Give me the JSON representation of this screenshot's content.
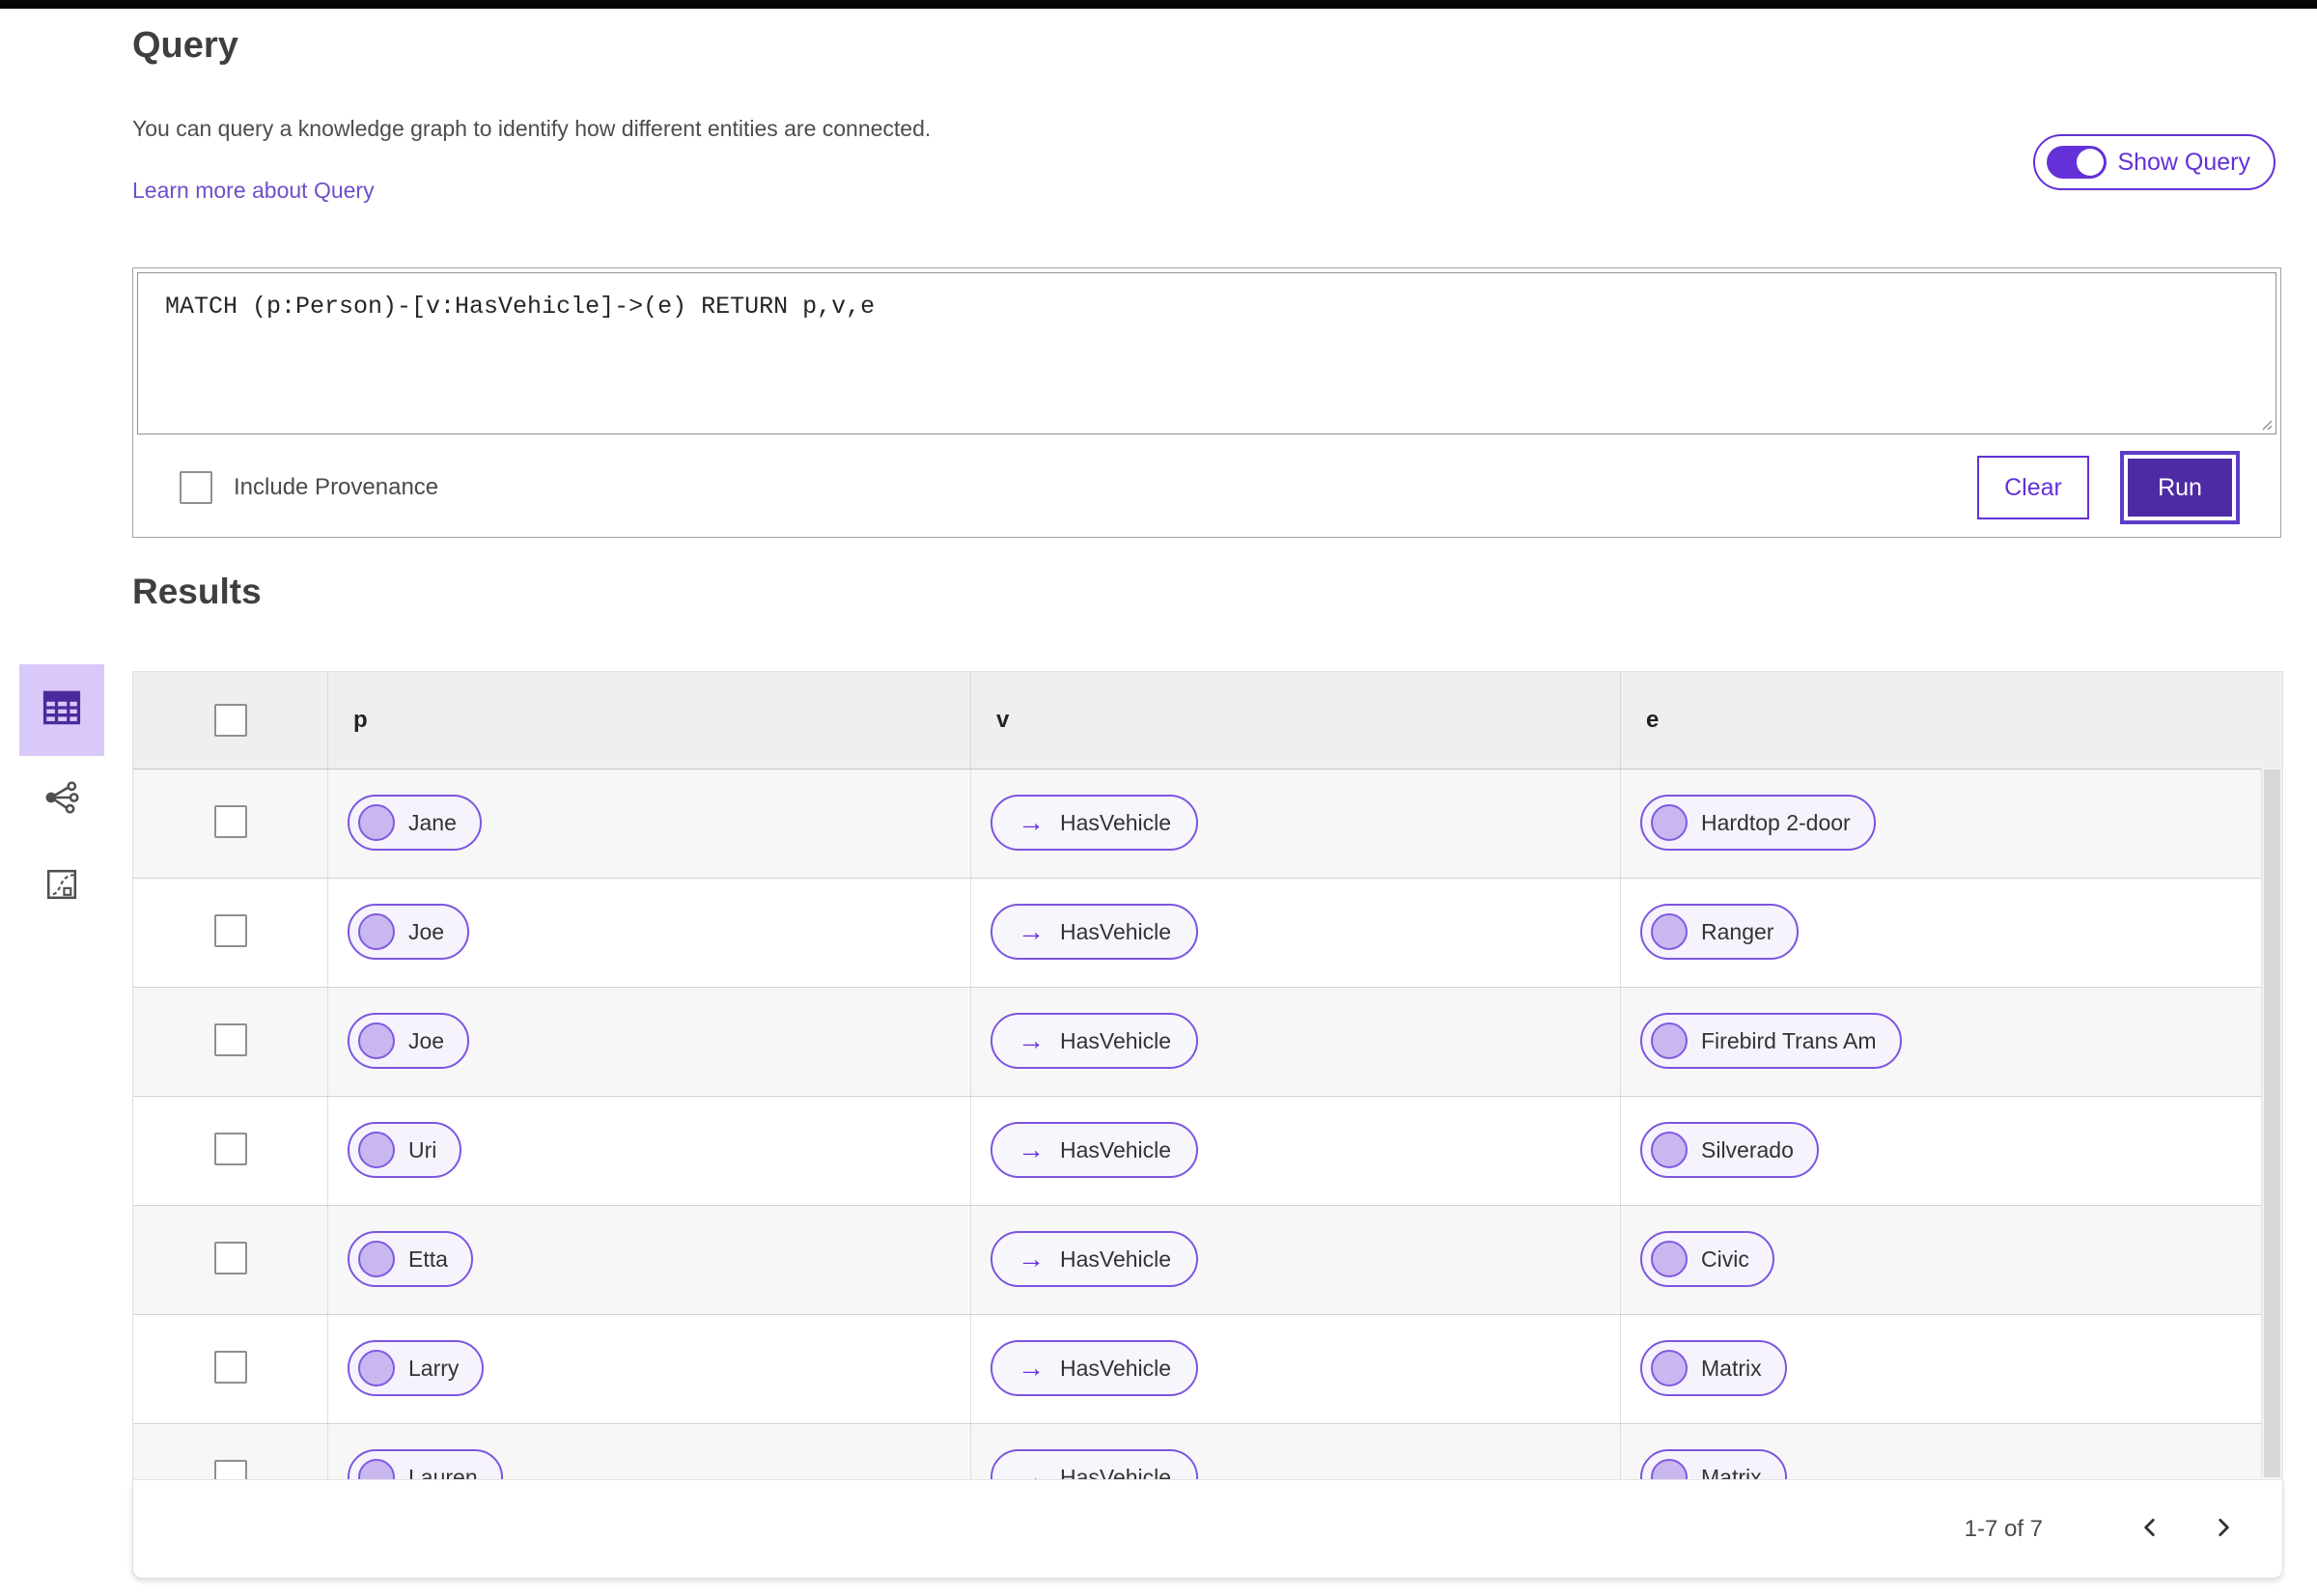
{
  "query": {
    "title": "Query",
    "description": "You can query a knowledge graph to identify how different entities are connected.",
    "learn_more_link": "Learn more about Query",
    "show_query_label": "Show Query",
    "show_query_on": true,
    "text": "MATCH (p:Person)-[v:HasVehicle]->(e) RETURN p,v,e",
    "include_provenance_label": "Include Provenance",
    "include_provenance_checked": false,
    "clear_label": "Clear",
    "run_label": "Run"
  },
  "results": {
    "title": "Results",
    "view_switcher": [
      {
        "name": "table-view",
        "icon": "table-icon",
        "selected": true
      },
      {
        "name": "graph-view",
        "icon": "network-graph-icon",
        "selected": false
      },
      {
        "name": "chart-view",
        "icon": "chart-icon",
        "selected": false
      }
    ]
  },
  "table": {
    "columns": [
      "p",
      "v",
      "e"
    ],
    "rows": [
      {
        "p": "Jane",
        "v": "HasVehicle",
        "e": "Hardtop 2-door"
      },
      {
        "p": "Joe",
        "v": "HasVehicle",
        "e": "Ranger"
      },
      {
        "p": "Joe",
        "v": "HasVehicle",
        "e": "Firebird Trans Am"
      },
      {
        "p": "Uri",
        "v": "HasVehicle",
        "e": "Silverado"
      },
      {
        "p": "Etta",
        "v": "HasVehicle",
        "e": "Civic"
      },
      {
        "p": "Larry",
        "v": "HasVehicle",
        "e": "Matrix"
      },
      {
        "p": "Lauren",
        "v": "HasVehicle",
        "e": "Matrix"
      }
    ]
  },
  "pagination": {
    "label": "1-7 of 7",
    "prev_icon": "chevron-left-icon",
    "next_icon": "chevron-right-icon"
  },
  "icons": {
    "relationship_arrow": "→"
  },
  "colors": {
    "accent_purple": "#6431d8",
    "run_button_bg": "#4e2ba4",
    "run_button_ring": "#5d3cc8",
    "pill_border": "#7d55e0",
    "pill_bg": "#f6f3fd",
    "node_circle_fill": "#c9b7f0",
    "selected_view_bg": "#d9c9f8",
    "link": "#6e4fc9",
    "header_bg": "#efeff0",
    "alt_row_bg": "#f7f7f7"
  }
}
